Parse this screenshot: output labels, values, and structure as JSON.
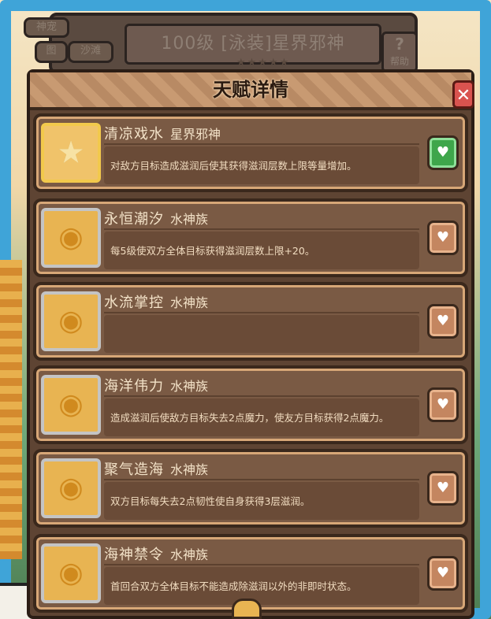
{
  "header": {
    "tabs": [
      "神宠",
      "沙滩",
      "图"
    ],
    "title": "100级 [泳装]星界邪神",
    "help_label": "帮助",
    "help_symbol": "?"
  },
  "panel": {
    "title": "天赋详情",
    "close_symbol": "✕"
  },
  "colors": {
    "active_heart": "#3ea64b",
    "inactive_heart": "#c48660",
    "card_bg": "#7a5a44",
    "title_text": "#2a1a10"
  },
  "talents": [
    {
      "name": "清凉戏水",
      "faction": "星界邪神",
      "desc": "对敌方目标造成滋润后使其获得滋润层数上限等量增加。",
      "icon": "star-icon",
      "favorited": true
    },
    {
      "name": "永恒潮汐",
      "faction": "水神族",
      "desc": "每5级使双方全体目标获得滋润层数上限+20。",
      "icon": "water-god-icon",
      "favorited": false
    },
    {
      "name": "水流掌控",
      "faction": "水神族",
      "desc": "",
      "icon": "water-god-icon",
      "favorited": false
    },
    {
      "name": "海洋伟力",
      "faction": "水神族",
      "desc": "造成滋润后使敌方目标失去2点魔力，使友方目标获得2点魔力。",
      "icon": "water-god-icon",
      "favorited": false
    },
    {
      "name": "聚气造海",
      "faction": "水神族",
      "desc": "双方目标每失去2点韧性使自身获得3层滋润。",
      "icon": "water-god-icon",
      "favorited": false
    },
    {
      "name": "海神禁令",
      "faction": "水神族",
      "desc": "首回合双方全体目标不能造成除滋润以外的非即时状态。",
      "icon": "water-god-icon",
      "favorited": false
    }
  ]
}
